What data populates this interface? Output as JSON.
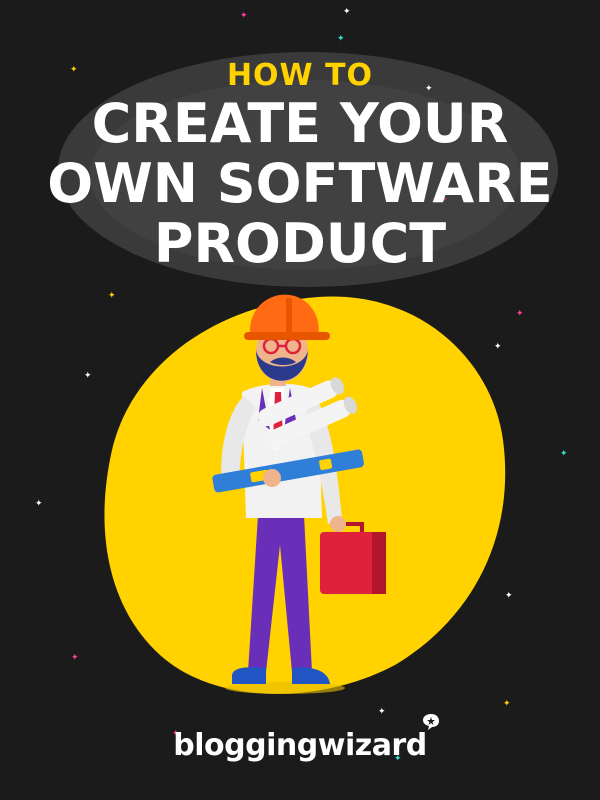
{
  "title": {
    "kicker": "HOW TO",
    "line1": "CREATE YOUR",
    "line2": "OWN SOFTWARE",
    "line3": "PRODUCT"
  },
  "brand": {
    "name": "bloggingwizard"
  },
  "colors": {
    "background": "#1b1b1b",
    "accent_yellow": "#ffd200",
    "text": "#ffffff",
    "hard_hat": "#ff6a13",
    "suit_pants": "#6a2fb8",
    "briefcase": "#e0213c"
  },
  "icons": [
    "sparkle-star-icon",
    "wizard-hat-icon"
  ]
}
